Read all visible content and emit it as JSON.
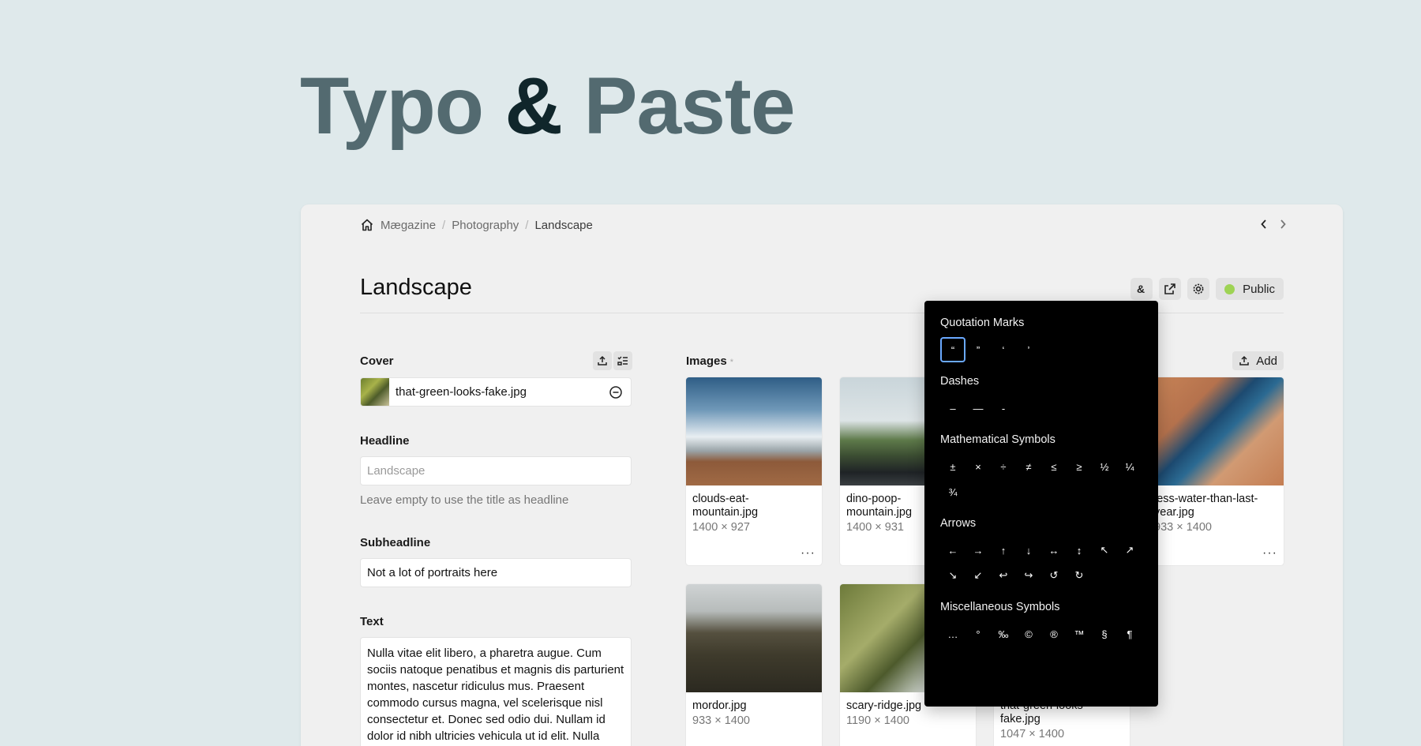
{
  "hero": {
    "word1": "Typo",
    "amp": "&",
    "word2": "Paste"
  },
  "breadcrumb": {
    "items": [
      "Mægazine",
      "Photography",
      "Landscape"
    ],
    "separator": "/"
  },
  "page": {
    "title": "Landscape",
    "visibility": "Public"
  },
  "cover": {
    "label": "Cover",
    "filename": "that-green-looks-fake.jpg"
  },
  "headline": {
    "label": "Headline",
    "placeholder": "Landscape",
    "hint": "Leave empty to use the title as headline"
  },
  "subheadline": {
    "label": "Subheadline",
    "value": "Not a lot of portraits here"
  },
  "text": {
    "label": "Text",
    "value": "Nulla vitae elit libero, a pharetra augue. Cum sociis natoque penatibus et magnis dis parturient montes, nascetur ridiculus mus. Praesent commodo cursus magna, vel scelerisque nisl consectetur et. Donec sed odio dui. Nullam id dolor id nibh ultricies vehicula ut id elit. Nulla vitae"
  },
  "images": {
    "label": "Images",
    "required_mark": "*",
    "add_label": "Add",
    "more_label": "···",
    "cards": [
      {
        "name": "clouds-eat-\nmountain.jpg",
        "dims": "1400 × 927"
      },
      {
        "name": "dino-poop-\nmountain.jpg",
        "dims": "1400 × 931"
      },
      {
        "name": "less-water-than-last-\nyear.jpg",
        "dims": "933 × 1400"
      },
      {
        "name": "mordor.jpg",
        "dims": "933 × 1400"
      },
      {
        "name": "scary-ridge.jpg",
        "dims": "1190 × 1400"
      },
      {
        "name": "that-green-looks-\nfake.jpg",
        "dims": "1047 × 1400"
      }
    ]
  },
  "palette": {
    "quotation": {
      "title": "Quotation Marks",
      "chars": [
        "“",
        "”",
        "‘",
        "’"
      ]
    },
    "dashes": {
      "title": "Dashes",
      "chars": [
        "–",
        "—",
        "-"
      ]
    },
    "math": {
      "title": "Mathematical Symbols",
      "chars": [
        "±",
        "×",
        "÷",
        "≠",
        "≤",
        "≥",
        "½",
        "¼",
        "¾"
      ]
    },
    "arrows": {
      "title": "Arrows",
      "chars": [
        "←",
        "→",
        "↑",
        "↓",
        "↔",
        "↕",
        "↖",
        "↗",
        "↘",
        "↙",
        "↩",
        "↪",
        "↺",
        "↻"
      ]
    },
    "misc": {
      "title": "Miscellaneous Symbols",
      "chars": [
        "…",
        "°",
        "‰",
        "©",
        "®",
        "™",
        "§",
        "¶"
      ]
    }
  },
  "colors": {
    "accent_green": "#9ed354",
    "selection": "#6aa9ff"
  }
}
